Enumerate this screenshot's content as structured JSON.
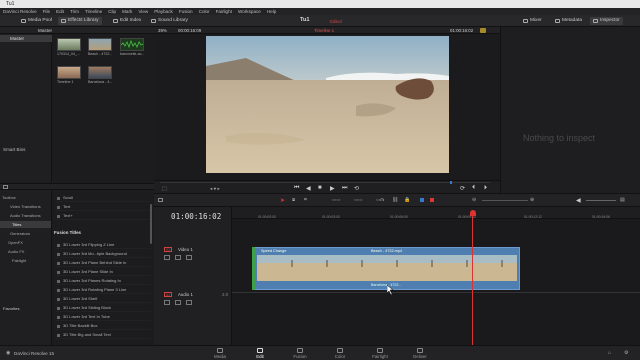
{
  "window_title": "Tu1",
  "menu": [
    "DaVinci Resolve",
    "File",
    "Edit",
    "Trim",
    "Timeline",
    "Clip",
    "Mark",
    "View",
    "Playback",
    "Fusion",
    "Color",
    "Fairlight",
    "Workspace",
    "Help"
  ],
  "toolbar": {
    "media_pool": "Media Pool",
    "effects_library": "Effects Library",
    "edit_index": "Edit Index",
    "sound_library": "Sound Library",
    "project": "Tu1",
    "edited": "Edited",
    "mixer": "Mixer",
    "metadata": "Metadata",
    "inspector": "Inspector"
  },
  "media_pool": {
    "bin": "Master",
    "bins": [
      "Master"
    ],
    "smart_bins": "Smart Bins",
    "clips": [
      {
        "name": "170314_04_...",
        "color": "#7a8a6a"
      },
      {
        "name": "Beach - 4722...",
        "color": "#9a8a70"
      },
      {
        "name": "baroxxeile-ac...",
        "color": "#2b5a2b"
      },
      {
        "name": "Timeline 1",
        "color": "#8a7a66"
      },
      {
        "name": "Barcelona - 4...",
        "color": "#5a6a7a"
      }
    ]
  },
  "effects": {
    "tree": [
      {
        "label": "Toolbox",
        "indent": 0
      },
      {
        "label": "Video Transitions",
        "indent": 1
      },
      {
        "label": "Audio Transitions",
        "indent": 1
      },
      {
        "label": "Titles",
        "indent": 1,
        "selected": true
      },
      {
        "label": "Generators",
        "indent": 1
      },
      {
        "label": "OpenFX",
        "indent": 0
      },
      {
        "label": "Audio FX",
        "indent": 0
      },
      {
        "label": "Fairlight",
        "indent": 1
      }
    ],
    "favorites": "Favorites",
    "basic": [
      "Scroll",
      "Text",
      "Text+"
    ],
    "fusion_header": "Fusion Titles",
    "fusion_titles": [
      "3D Lower 3rd Flipping Z Line",
      "3D Lower 3rd Mu...tiple Background",
      "3D Lower 3rd Plane Behind Slide In",
      "3D Lower 3rd Plane Slide In",
      "3D Lower 3rd Planes Rotating In",
      "3D Lower 3rd Rotating Plane 3 Line",
      "3D Lower 3rd Shelf",
      "3D Lower 3rd Sliding Block",
      "3D Lower 3rd Text In Tube",
      "3D Title Backlit Box",
      "3D Title Big and Small Text"
    ]
  },
  "viewer": {
    "zoom": "39%",
    "timecode_left": "00:00:16:09",
    "timeline_name": "Timeline 1",
    "timecode_right": "01:00:16:02"
  },
  "inspector": {
    "empty": "Nothing to inspect"
  },
  "timeline": {
    "timecode": "01:00:16:02",
    "video_track": "Video 1",
    "audio_track": "Audio 1",
    "v_tag": "V1",
    "a_tag": "A1",
    "audio_ch": "2.0",
    "clip_fx": "Speed Change",
    "clip_name": "Beach - 4722.mp4",
    "clip_tc": "Barcelona - 4722...",
    "ticks": [
      "01:00:00:00",
      "01:00:03:00",
      "01:00:06:00",
      "01:00:09:12",
      "01:00:12:12",
      "01:00:16:06",
      "01:00:18:12",
      "01:00:21:12"
    ]
  },
  "nav": [
    "Media",
    "Edit",
    "Fusion",
    "Color",
    "Fairlight",
    "Deliver"
  ],
  "active_nav": "Edit",
  "app": "DaVinci Resolve 15",
  "colors": {
    "accent": "#d23a3a",
    "clip": "#4f7fb0",
    "audio": "#2e6a3a"
  }
}
